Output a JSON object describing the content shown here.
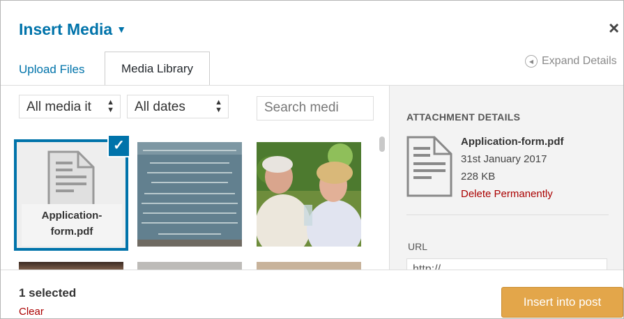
{
  "modal": {
    "title": "Insert Media",
    "title_caret": "▼",
    "close": "×"
  },
  "tabs": {
    "upload": "Upload Files",
    "library": "Media Library"
  },
  "expand_details": "Expand Details",
  "filters": {
    "media_type": "All media it",
    "dates": "All dates",
    "search_placeholder": "Search medi"
  },
  "attachments": [
    {
      "filename": "Application-form.pdf",
      "filename_line1": "Application-",
      "filename_line2": "form.pdf",
      "selected": true
    },
    {
      "kind": "image",
      "icon": "image-plaque"
    },
    {
      "kind": "image",
      "icon": "image-couple"
    }
  ],
  "sidebar": {
    "heading": "ATTACHMENT DETAILS",
    "filename": "Application-form.pdf",
    "date": "31st January 2017",
    "size": "228 KB",
    "delete": "Delete Permanently",
    "url_label": "URL",
    "url_value": "http://..."
  },
  "toolbar": {
    "selected_count": "1 selected",
    "clear": "Clear",
    "insert": "Insert into post"
  },
  "colors": {
    "accent": "#0073aa",
    "button": "#e3a64a",
    "danger": "#a00000"
  }
}
